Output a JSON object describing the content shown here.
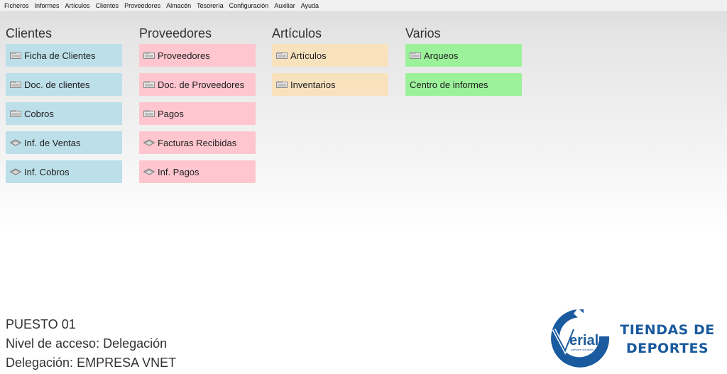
{
  "menu": [
    "Ficheros",
    "Informes",
    "Artículos",
    "Clientes",
    "Proveedores",
    "Almacén",
    "Tesorería",
    "Configuración",
    "Auxiliar",
    "Ayuda"
  ],
  "groups": [
    {
      "title": "Clientes",
      "tiles": [
        "Ficha de Clientes",
        "Doc. de clientes",
        "Cobros",
        "Inf. de Ventas",
        "Inf. Cobros"
      ]
    },
    {
      "title": "Proveedores",
      "tiles": [
        "Proveedores",
        "Doc. de Proveedores",
        "Pagos",
        "Facturas Recibidas",
        "Inf. Pagos"
      ]
    },
    {
      "title": "Artículos",
      "tiles": [
        "Artículos",
        "Inventarios"
      ]
    },
    {
      "title": "Varios",
      "tiles": [
        "Arqueos",
        "Centro de informes"
      ]
    }
  ],
  "info": {
    "puesto": "PUESTO 01",
    "nivel": "Nivel de acceso: Delegación",
    "delegacion": "Delegación: EMPRESA VNET"
  },
  "logo": {
    "text": "erial",
    "tagline": "software solutions"
  },
  "brand": {
    "line1": "TIENDAS DE",
    "line2": "DEPORTES"
  },
  "colors": {
    "clientes": "#bcdfe9",
    "proveedores": "#ffc6cf",
    "articulos": "#f8e2be",
    "varios": "#9cf29a",
    "brand": "#1a5a9e"
  }
}
